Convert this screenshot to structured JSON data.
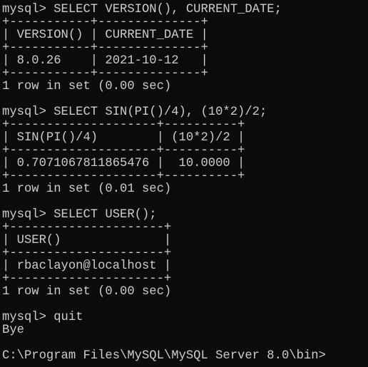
{
  "terminal": {
    "foreground": "#cccccc",
    "background": "#0c0c0c",
    "lines": [
      "mysql> SELECT VERSION(), CURRENT_DATE;",
      "+-----------+--------------+",
      "| VERSION() | CURRENT_DATE |",
      "+-----------+--------------+",
      "| 8.0.26    | 2021-10-12   |",
      "+-----------+--------------+",
      "1 row in set (0.00 sec)",
      "",
      "mysql> SELECT SIN(PI()/4), (10*2)/2;",
      "+--------------------+----------+",
      "| SIN(PI()/4)        | (10*2)/2 |",
      "+--------------------+----------+",
      "| 0.7071067811865476 |  10.0000 |",
      "+--------------------+----------+",
      "1 row in set (0.01 sec)",
      "",
      "mysql> SELECT USER();",
      "+---------------------+",
      "| USER()              |",
      "+---------------------+",
      "| rbaclayon@localhost |",
      "+---------------------+",
      "1 row in set (0.00 sec)",
      "",
      "mysql> quit",
      "Bye",
      "",
      "C:\\Program Files\\MySQL\\MySQL Server 8.0\\bin>"
    ]
  }
}
